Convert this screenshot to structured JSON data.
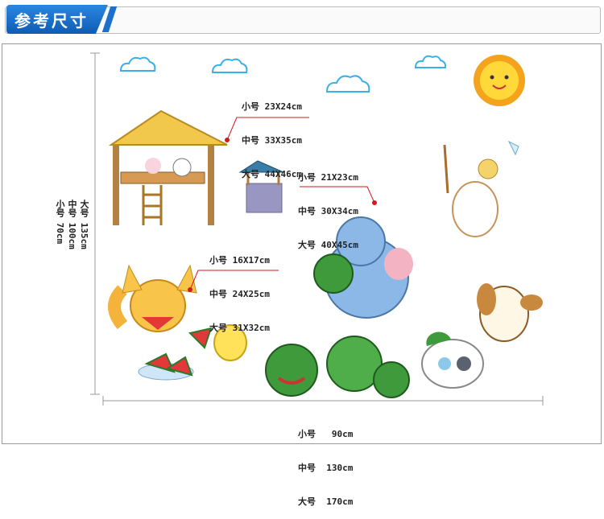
{
  "header": {
    "title": "参考尺寸"
  },
  "labels": {
    "house": [
      "小号 23X24cm",
      "中号 33X35cm",
      "大号 44X46cm"
    ],
    "elephant": [
      "小号 21X23cm",
      "中号 30X34cm",
      "大号 40X45cm"
    ],
    "fox": [
      "小号 16X17cm",
      "中号 24X25cm",
      "大号 31X32cm"
    ],
    "width": [
      "小号   90cm",
      "中号  130cm",
      "大号  170cm"
    ],
    "height": [
      "小号 70cm",
      "中号 100cm",
      "大号 135cm"
    ]
  },
  "colors": {
    "accent": "#1565c0",
    "leader": "#d21a1a",
    "straw": "#f1c84b",
    "melon": "#3e9a3a"
  }
}
